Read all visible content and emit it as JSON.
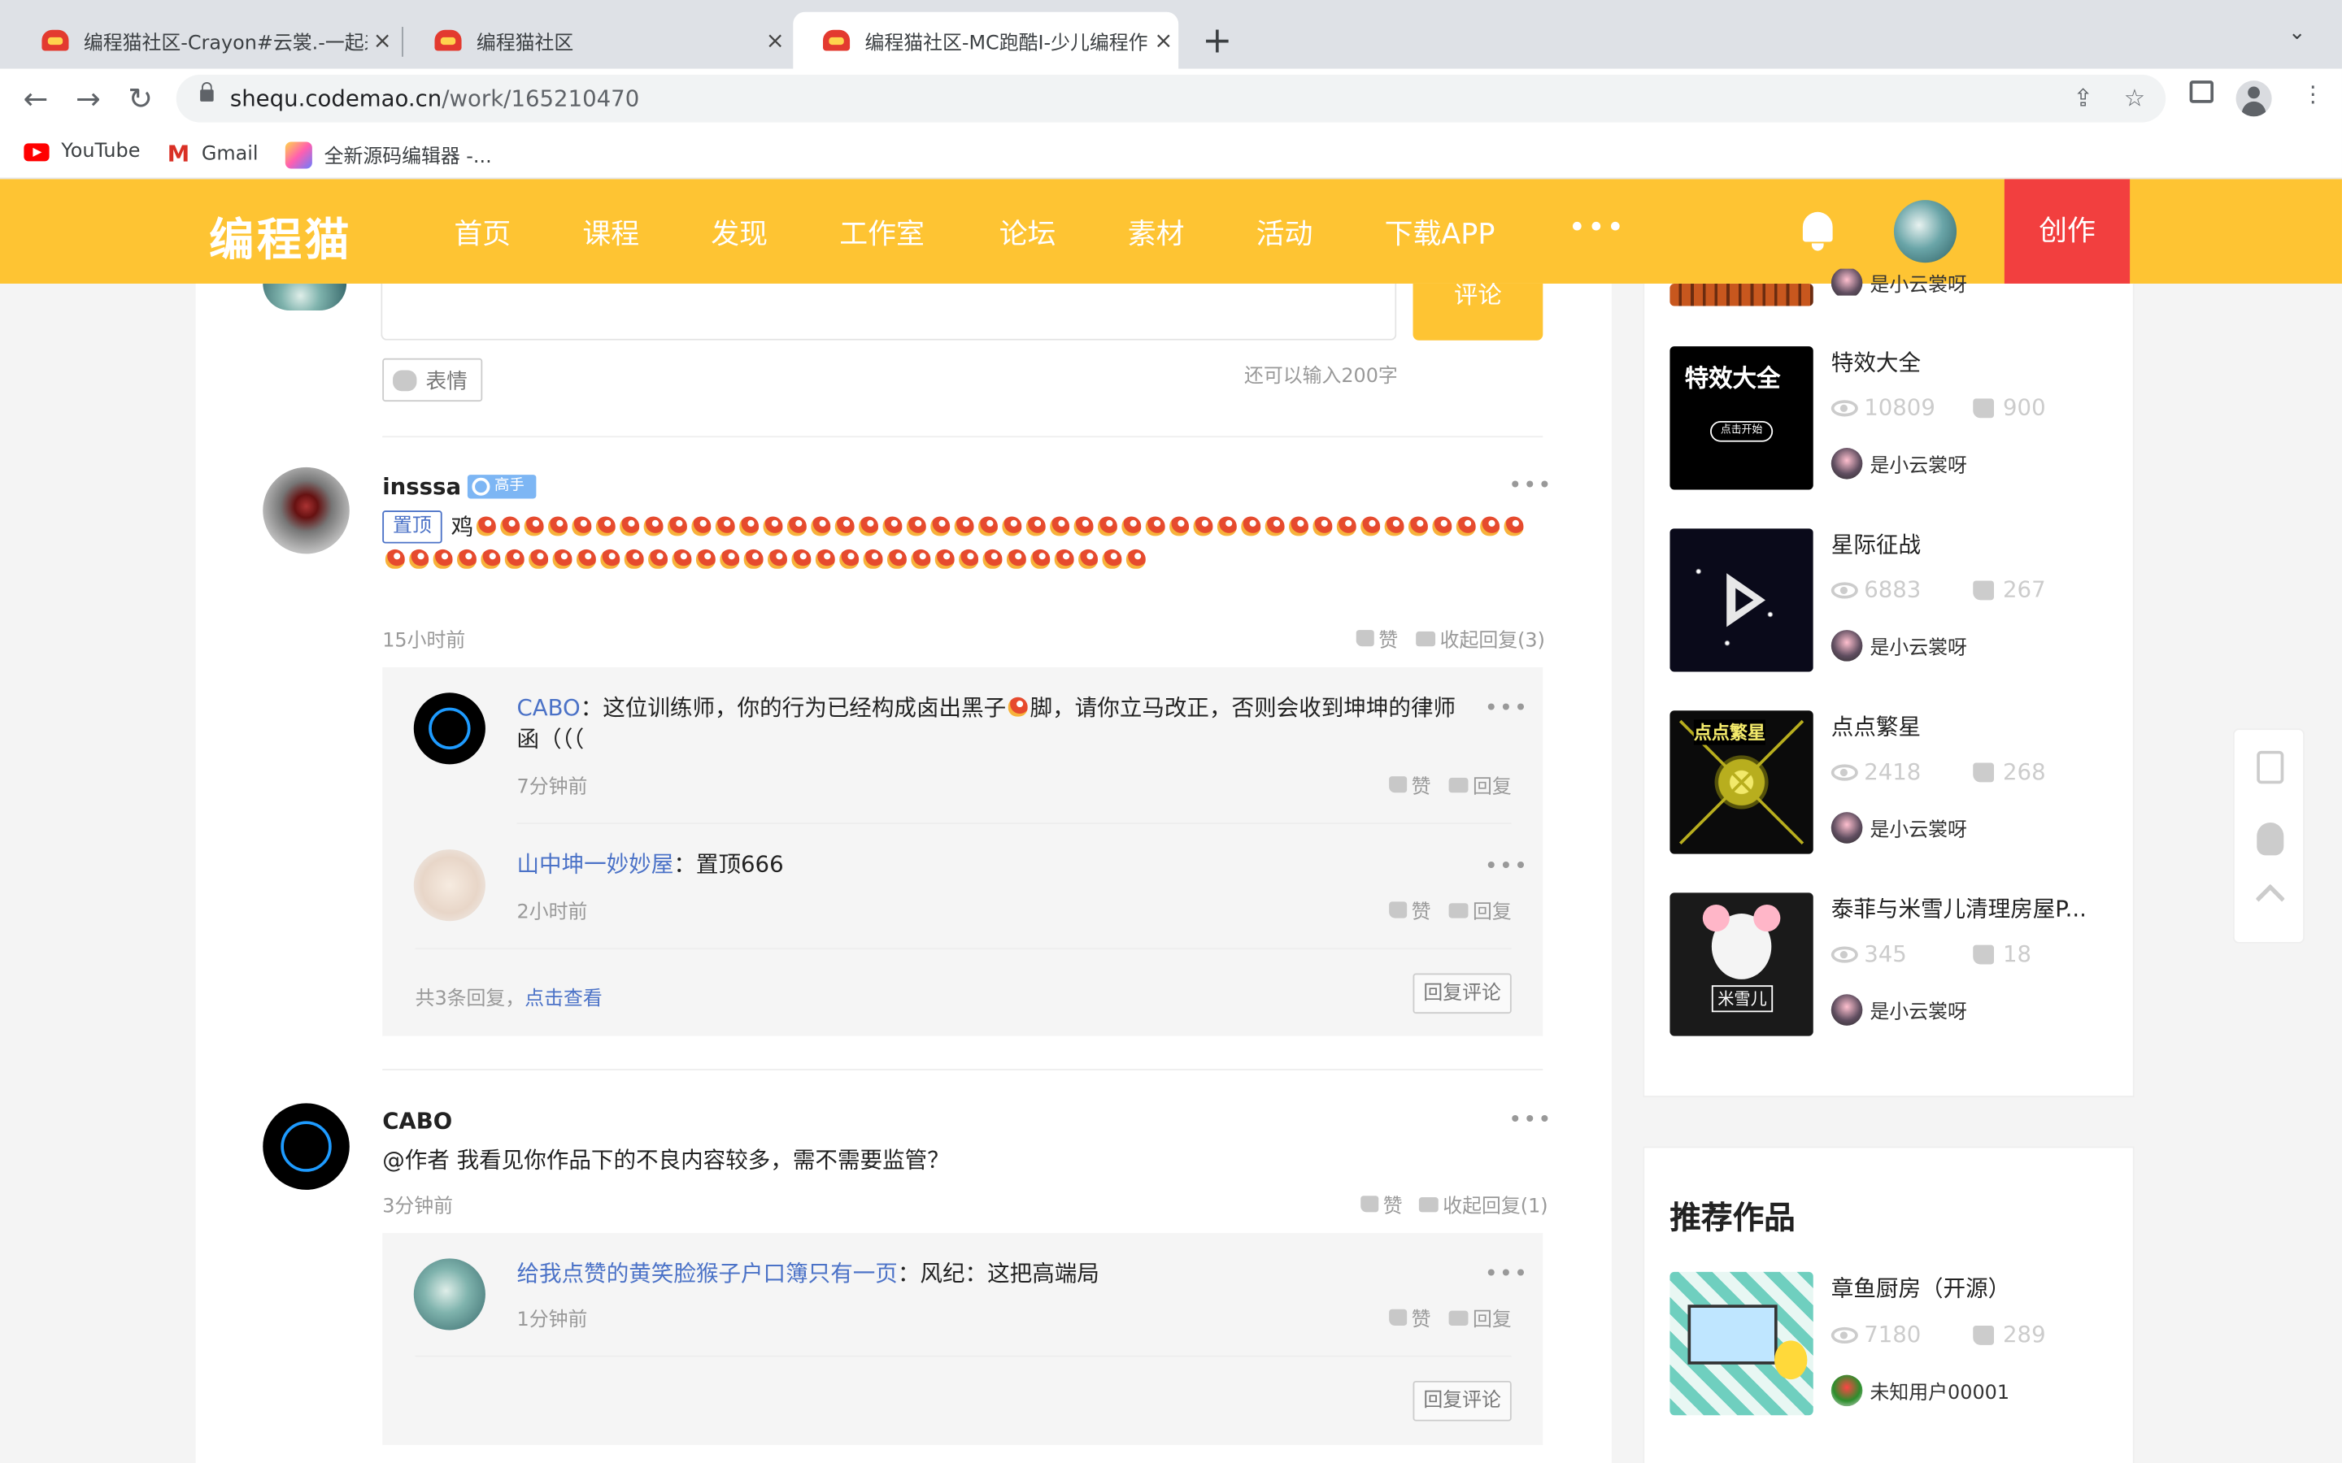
{
  "browser": {
    "tabs": [
      {
        "title": "编程猫社区-Crayon#云裳.-一起来",
        "close": "×",
        "active": false
      },
      {
        "title": "编程猫社区",
        "close": "×",
        "active": false
      },
      {
        "title": "编程猫社区-MC跑酷I-少儿编程作品",
        "close": "×",
        "active": true
      }
    ],
    "new_tab": "+",
    "tab_menu": "⌄",
    "url_host": "shequ.codemao.cn",
    "url_path": "/work/165210470",
    "bookmarks": [
      {
        "label": "YouTube",
        "icon": "youtube-icon"
      },
      {
        "label": "Gmail",
        "icon": "gmail-icon"
      },
      {
        "label": "全新源码编辑器 -...",
        "icon": "editor-icon"
      }
    ]
  },
  "site": {
    "logo": "编程猫",
    "nav": [
      "首页",
      "课程",
      "发现",
      "工作室",
      "论坛",
      "素材",
      "活动",
      "下载APP"
    ],
    "more": "•••",
    "create": "创作"
  },
  "composer": {
    "submit": "评论",
    "emoji": "表情",
    "counter": "还可以输入200字"
  },
  "comments": [
    {
      "user": "insssa",
      "badge": "高手",
      "pinned": "置顶",
      "text_prefix": "鸡",
      "emoji_count": 76,
      "time": "15小时前",
      "like": "赞",
      "collapse": "收起回复(3)",
      "replies": [
        {
          "user": "CABO",
          "text": "：这位训练师，你的行为已经构成卤出黑子",
          "text2": "脚，请你立马改正，否则会收到坤坤的律师函（（（",
          "time": "7分钟前",
          "like": "赞",
          "reply": "回复"
        },
        {
          "user": "山中坤一妙妙屋",
          "text": "：置顶666",
          "time": "2小时前",
          "like": "赞",
          "reply": "回复"
        }
      ],
      "total": "共3条回复，",
      "view": "点击查看",
      "reply_btn": "回复评论"
    },
    {
      "user": "CABO",
      "text": "@作者 我看见你作品下的不良内容较多，需不需要监管？",
      "time": "3分钟前",
      "like": "赞",
      "collapse": "收起回复(1)",
      "replies": [
        {
          "user": "给我点赞的黄笑脸猴子户口簿只有一页",
          "text": "：风纪：这把高端局",
          "time": "1分钟前",
          "like": "赞",
          "reply": "回复"
        }
      ],
      "reply_btn": "回复评论"
    }
  ],
  "sidebar": {
    "top_partial_author": "是小云裳呀",
    "works": [
      {
        "title": "特效大全",
        "thumb_text": "特效大全",
        "thumb_btn": "点击开始",
        "views": "10809",
        "likes": "900",
        "author": "是小云裳呀"
      },
      {
        "title": "星际征战",
        "views": "6883",
        "likes": "267",
        "author": "是小云裳呀"
      },
      {
        "title": "点点繁星",
        "thumb_text": "点点繁星",
        "views": "2418",
        "likes": "268",
        "author": "是小云裳呀"
      },
      {
        "title": "泰菲与米雪儿清理房屋P...",
        "thumb_text": "米雪儿",
        "views": "345",
        "likes": "18",
        "author": "是小云裳呀"
      }
    ],
    "recommend_title": "推荐作品",
    "recommend": [
      {
        "title": "章鱼厨房（开源）",
        "views": "7180",
        "likes": "289",
        "author": "未知用户00001"
      }
    ]
  },
  "colors": {
    "brand": "#fec433",
    "create": "#f23f3f",
    "link": "#4b72c7"
  }
}
